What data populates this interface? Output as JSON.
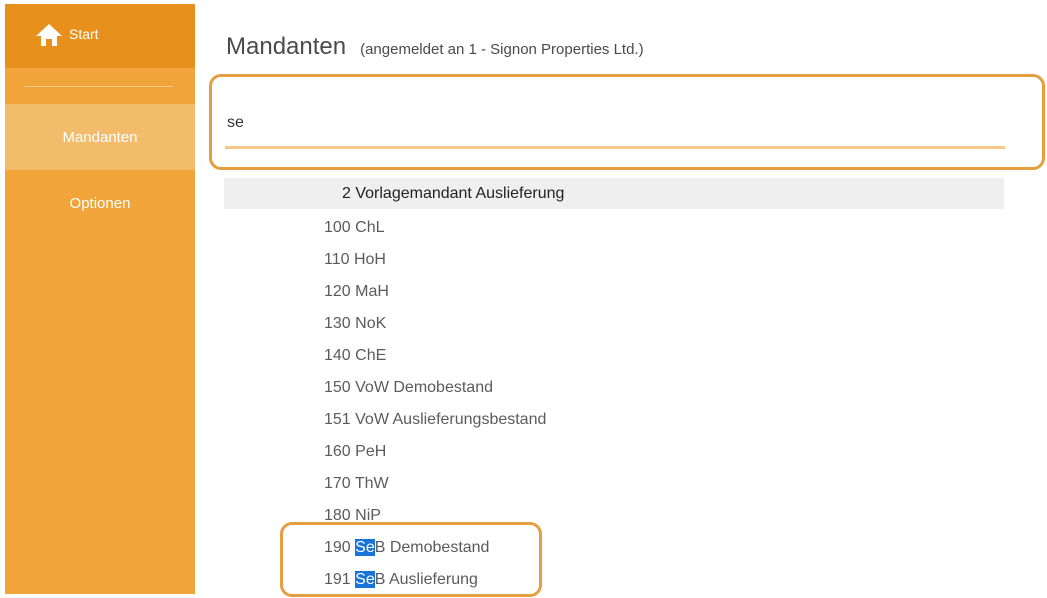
{
  "sidebar": {
    "start_label": "Start",
    "start_icon": "home-icon",
    "items": [
      {
        "label": "Mandanten",
        "active": true
      },
      {
        "label": "Optionen",
        "active": false
      }
    ],
    "colors": {
      "background": "#f0a43a",
      "start_background": "#e8901c",
      "active_background": "#f3bc6b"
    }
  },
  "header": {
    "title": "Mandanten",
    "subtitle": "(angemeldet an 1 - Signon Properties Ltd.)"
  },
  "search": {
    "value": "se",
    "accent_color": "#e59f40"
  },
  "list": {
    "selected": "2 Vorlagemandant Auslieferung",
    "items": [
      {
        "text": "100 ChL"
      },
      {
        "text": "110 HoH"
      },
      {
        "text": "120 MaH"
      },
      {
        "text": "130 NoK"
      },
      {
        "text": "140 ChE"
      },
      {
        "text": "150 VoW Demobestand"
      },
      {
        "text": "151 VoW Auslieferungsbestand"
      },
      {
        "text": "160 PeH"
      },
      {
        "text": "170 ThW"
      },
      {
        "text": "180 NiP"
      },
      {
        "text": "190 SeB Demobestand",
        "pre": "190 ",
        "match": "Se",
        "post": "B Demobestand"
      },
      {
        "text": "191 SeB Auslieferung",
        "pre": "191 ",
        "match": "Se",
        "post": "B Auslieferung"
      }
    ],
    "highlight_color": "#1a73d9"
  }
}
